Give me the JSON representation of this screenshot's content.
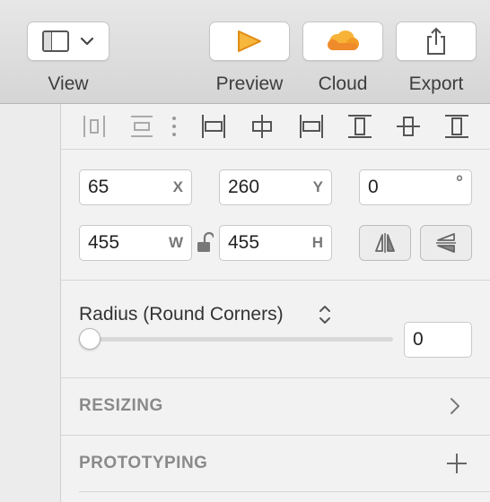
{
  "toolbar": {
    "view_label": "View",
    "preview_label": "Preview",
    "cloud_label": "Cloud",
    "export_label": "Export"
  },
  "icons": {
    "view": "sidebar-layout-icon",
    "preview": "play-triangle-icon",
    "cloud": "cloud-icon",
    "export": "share-icon"
  },
  "position": {
    "x": {
      "value": "65",
      "unit": "X"
    },
    "y": {
      "value": "260",
      "unit": "Y"
    },
    "rotation": {
      "value": "0",
      "unit": "°"
    }
  },
  "size": {
    "w": {
      "value": "455",
      "unit": "W"
    },
    "h": {
      "value": "455",
      "unit": "H"
    }
  },
  "radius": {
    "label": "Radius (Round Corners)",
    "value": "0",
    "slider_fraction": 0
  },
  "sections": {
    "resizing": "RESIZING",
    "prototyping": "PROTOTYPING"
  },
  "colors": {
    "preview_accent": "#f5a623",
    "cloud_accent": "#f3a02b"
  }
}
